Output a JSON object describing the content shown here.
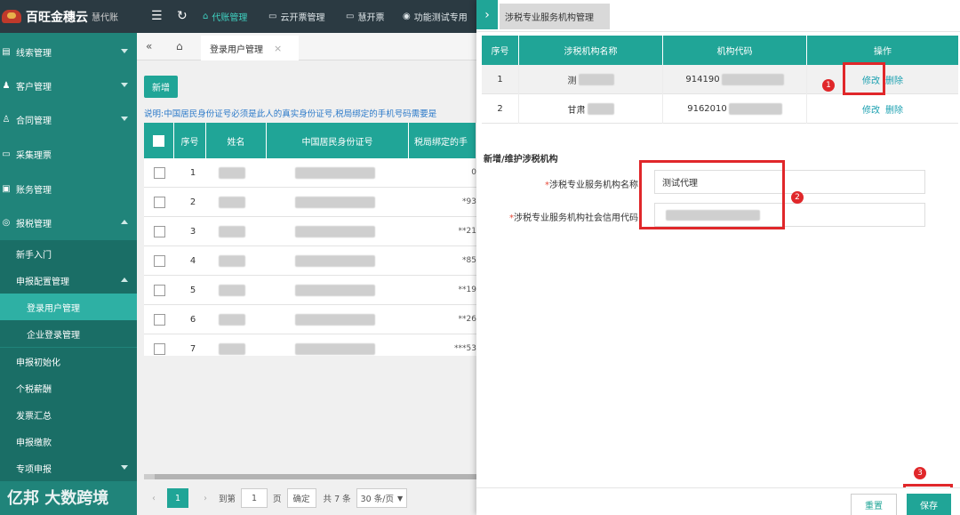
{
  "app": {
    "logo_name": "百旺金穗云",
    "logo_sub": "慧代账"
  },
  "topnav": [
    {
      "label": "代账管理",
      "icon": "home-icon",
      "active": true
    },
    {
      "label": "云开票管理",
      "icon": "invoice-icon",
      "active": false
    },
    {
      "label": "慧开票",
      "icon": "invoice-icon",
      "active": false
    },
    {
      "label": "功能测试专用",
      "icon": "user-icon",
      "active": false
    }
  ],
  "sidebar": {
    "items": [
      {
        "label": "线索管理",
        "icon": "clue-icon"
      },
      {
        "label": "客户管理",
        "icon": "customer-icon"
      },
      {
        "label": "合同管理",
        "icon": "contract-icon"
      },
      {
        "label": "采集理票",
        "icon": "collect-icon"
      },
      {
        "label": "账务管理",
        "icon": "account-icon"
      },
      {
        "label": "报税管理",
        "icon": "tax-icon"
      }
    ],
    "sub_items": [
      {
        "label": "新手入门"
      },
      {
        "label": "申报配置管理"
      },
      {
        "label": "登录用户管理"
      },
      {
        "label": "企业登录管理"
      },
      {
        "label": "申报初始化"
      },
      {
        "label": "个税薪酬"
      },
      {
        "label": "发票汇总"
      },
      {
        "label": "申报缴款"
      },
      {
        "label": "专项申报"
      }
    ]
  },
  "main": {
    "tab_label": "登录用户管理",
    "new_button": "新增",
    "note": "说明:中国居民身份证号必须是此人的真实身份证号,税局绑定的手机号码需要是",
    "table": {
      "headers": [
        "序号",
        "姓名",
        "中国居民身份证号",
        "税局绑定的手"
      ],
      "rows": [
        {
          "no": "1",
          "tail": "0"
        },
        {
          "no": "2",
          "tail": "*93"
        },
        {
          "no": "3",
          "tail": "**21"
        },
        {
          "no": "4",
          "tail": "*85"
        },
        {
          "no": "5",
          "tail": "**19"
        },
        {
          "no": "6",
          "tail": "**26"
        },
        {
          "no": "7",
          "tail": "***53"
        }
      ]
    },
    "pager": {
      "current": "1",
      "goto_label": "到第",
      "page_input": "1",
      "page_unit": "页",
      "confirm": "确定",
      "total": "共 7 条",
      "page_size": "30 条/页"
    }
  },
  "watermark": "亿邦 大数跨境",
  "panel": {
    "tab_label": "涉税专业服务机构管理",
    "table": {
      "headers": [
        "序号",
        "涉税机构名称",
        "机构代码",
        "操作"
      ],
      "rows": [
        {
          "no": "1",
          "name": "测",
          "code": "914190",
          "edit": "修改",
          "delete": "删除"
        },
        {
          "no": "2",
          "name": "甘肃",
          "code": "9162010",
          "edit": "修改",
          "delete": "删除"
        }
      ]
    },
    "section_title": "新增/维护涉税机构",
    "form": {
      "name_label": "涉税专业服务机构名称",
      "name_value": "测试代理",
      "code_label": "涉税专业服务机构社会信用代码",
      "code_value": ""
    },
    "badges": [
      "1",
      "2",
      "3"
    ],
    "reset": "重置",
    "save": "保存"
  }
}
